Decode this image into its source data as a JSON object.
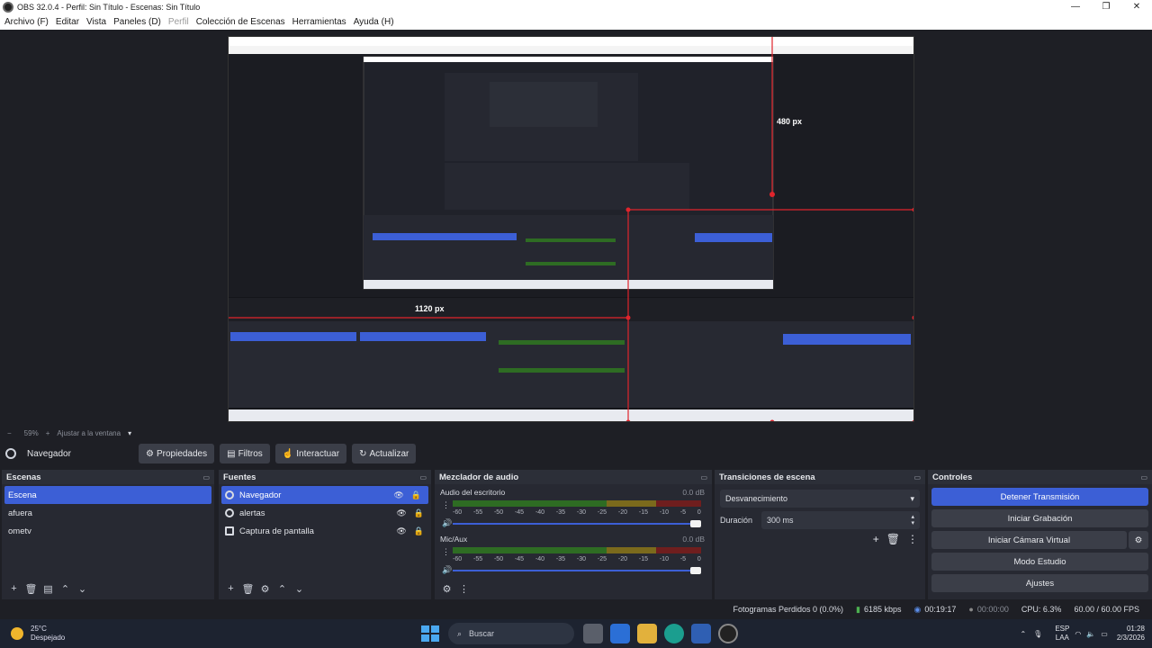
{
  "window": {
    "title": "OBS 32.0.4 - Perfil: Sin Título - Escenas: Sin Título",
    "controls": [
      "—",
      "❐",
      "✕"
    ]
  },
  "menu": [
    "Archivo (F)",
    "Editar",
    "Vista",
    "Paneles (D)",
    "Perfil",
    "Colección de Escenas",
    "Herramientas",
    "Ayuda (H)"
  ],
  "zoom": {
    "percent": "59%",
    "fit_label": "Ajustar a la ventana"
  },
  "navbar": {
    "source": "Navegador",
    "properties": "Propiedades",
    "filters": "Filtros",
    "interact": "Interactuar",
    "refresh": "Actualizar"
  },
  "scenes": {
    "title": "Escenas",
    "items": [
      "Escena",
      "afuera",
      "ometv"
    ]
  },
  "sources": {
    "title": "Fuentes",
    "items": [
      "Navegador",
      "alertas",
      "Captura de pantalla"
    ]
  },
  "mixer": {
    "title": "Mezclador de audio",
    "channels": [
      {
        "name": "Audio del escritorio",
        "db": "0.0 dB"
      },
      {
        "name": "Mic/Aux",
        "db": "0.0 dB"
      }
    ],
    "scale": [
      "-60",
      "-55",
      "-50",
      "-45",
      "-40",
      "-35",
      "-30",
      "-25",
      "-20",
      "-15",
      "-10",
      "-5",
      "0"
    ]
  },
  "transitions": {
    "title": "Transiciones de escena",
    "type": "Desvanecimiento",
    "duration_label": "Duración",
    "duration": "300 ms"
  },
  "controls": {
    "title": "Controles",
    "buttons": [
      "Detener Transmisión",
      "Iniciar Grabación",
      "Iniciar Cámara Virtual",
      "Modo Estudio",
      "Ajustes"
    ]
  },
  "preview": {
    "label_h": "480 px",
    "label_w": "1120 px"
  },
  "status": {
    "dropped": "Fotogramas Perdidos 0 (0.0%)",
    "bitrate": "6185 kbps",
    "stream_time": "00:19:17",
    "rec_time": "00:00:00",
    "cpu": "CPU: 6.3%",
    "fps": "60.00 / 60.00 FPS"
  },
  "taskbar": {
    "weather_temp": "25°C",
    "weather_desc": "Despejado",
    "search": "Buscar",
    "lang1": "ESP",
    "lang2": "LAA",
    "time": "01:28",
    "date": "2/3/2026"
  },
  "colors": {
    "accent": "#3c5fd6",
    "panel": "#272932",
    "bg": "#1e1f25"
  }
}
